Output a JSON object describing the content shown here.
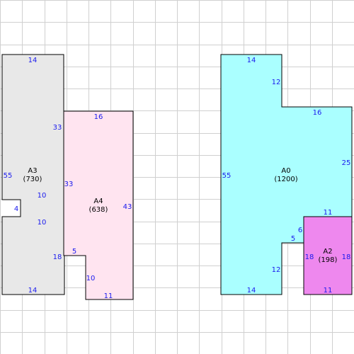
{
  "grid": {
    "line_color": "#d0d0d0"
  },
  "shapes": [
    {
      "id": "A3",
      "name": "A3",
      "area_label": "(730)",
      "fill": "#e8e8e8",
      "dims": [
        "14",
        "33",
        "10",
        "4",
        "10",
        "18",
        "14",
        "55"
      ]
    },
    {
      "id": "A4",
      "name": "A4",
      "area_label": "(638)",
      "fill": "#ffe4f0",
      "dims": [
        "16",
        "43",
        "11",
        "10",
        "5",
        "33"
      ]
    },
    {
      "id": "A0",
      "name": "A0",
      "area_label": "(1200)",
      "fill": "#aaffff",
      "dims": [
        "14",
        "12",
        "16",
        "25",
        "11",
        "6",
        "5",
        "12",
        "14",
        "55"
      ]
    },
    {
      "id": "A2",
      "name": "A2",
      "area_label": "(198)",
      "fill": "#ee88ee",
      "dims": [
        "18",
        "11",
        "18"
      ]
    }
  ]
}
